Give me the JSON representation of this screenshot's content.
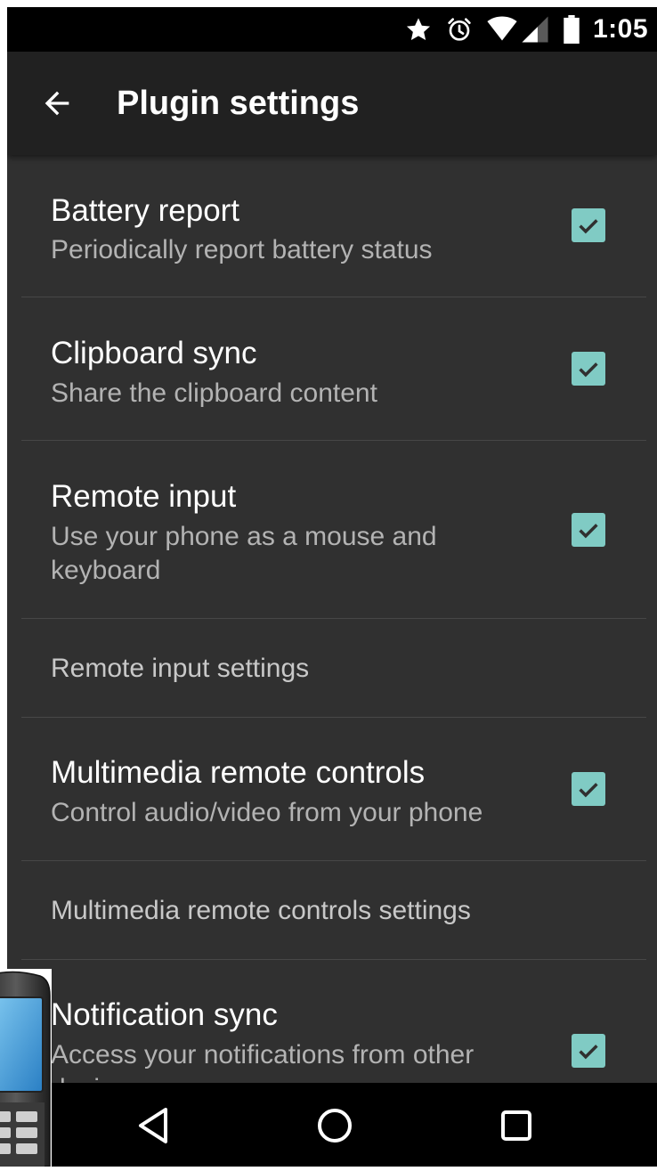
{
  "status_bar": {
    "time": "1:05",
    "icons": [
      "star-icon",
      "alarm-icon",
      "wifi-icon",
      "cell-signal-icon",
      "battery-icon"
    ]
  },
  "toolbar": {
    "title": "Plugin settings",
    "back_icon": "arrow-back-icon"
  },
  "colors": {
    "accent": "#80cbc4",
    "background": "#303030",
    "toolbar": "#212121",
    "divider": "#474747"
  },
  "preferences": [
    {
      "title": "Battery report",
      "summary": "Periodically report battery status",
      "checked": true
    },
    {
      "title": "Clipboard sync",
      "summary": "Share the clipboard content",
      "checked": true
    },
    {
      "title": "Remote input",
      "summary": "Use your phone as a mouse and keyboard",
      "checked": true
    },
    {
      "title": "Remote input settings"
    },
    {
      "title": "Multimedia remote controls",
      "summary": "Control audio/video from your phone",
      "checked": true
    },
    {
      "title": "Multimedia remote controls settings"
    },
    {
      "title": "Notification sync",
      "summary": "Access your notifications from other devices",
      "checked": true
    }
  ],
  "nav_bar": {
    "icons": [
      "nav-back-icon",
      "nav-home-icon",
      "nav-recents-icon"
    ]
  }
}
